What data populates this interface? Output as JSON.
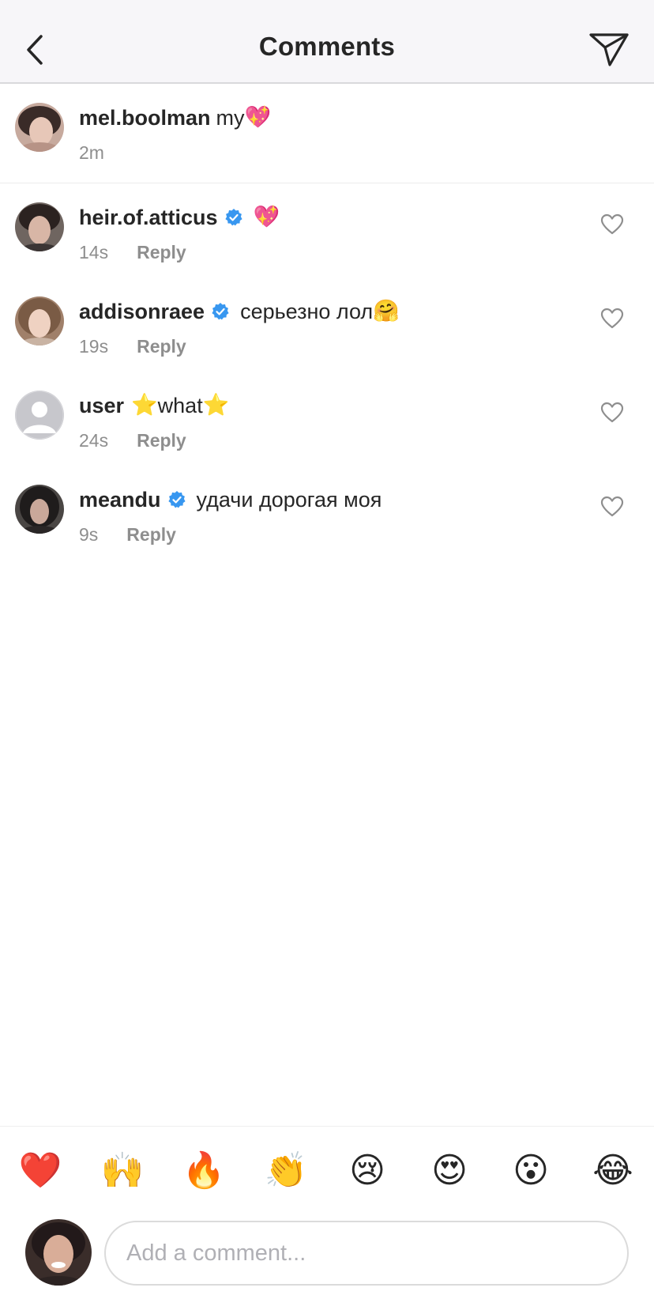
{
  "header": {
    "title": "Comments"
  },
  "caption": {
    "username": "mel.boolman",
    "text": "my",
    "emoji": "💖",
    "time": "2m"
  },
  "comments": [
    {
      "username": "heir.of.atticus",
      "verified": true,
      "text": "",
      "emoji": "💖",
      "time": "14s",
      "reply_label": "Reply"
    },
    {
      "username": "addisonraee",
      "verified": true,
      "text": "серьезно лол",
      "emoji": "🤗",
      "time": "19s",
      "reply_label": "Reply"
    },
    {
      "username": "user",
      "verified": false,
      "text": "what",
      "emoji": "⭐",
      "time": "24s",
      "reply_label": "Reply"
    },
    {
      "username": "meandu",
      "verified": true,
      "text": "удачи дорогая моя",
      "emoji": "",
      "time": "9s",
      "reply_label": "Reply"
    }
  ],
  "reactions": [
    "❤️",
    "🙌",
    "🔥",
    "👏",
    "😢",
    "😍",
    "😮",
    "😂"
  ],
  "composer": {
    "placeholder": "Add a comment..."
  },
  "colors": {
    "verified": "#3897f0",
    "secondary_text": "#8e8e8e",
    "primary_text": "#262626",
    "header_bg": "#f7f6f9"
  }
}
